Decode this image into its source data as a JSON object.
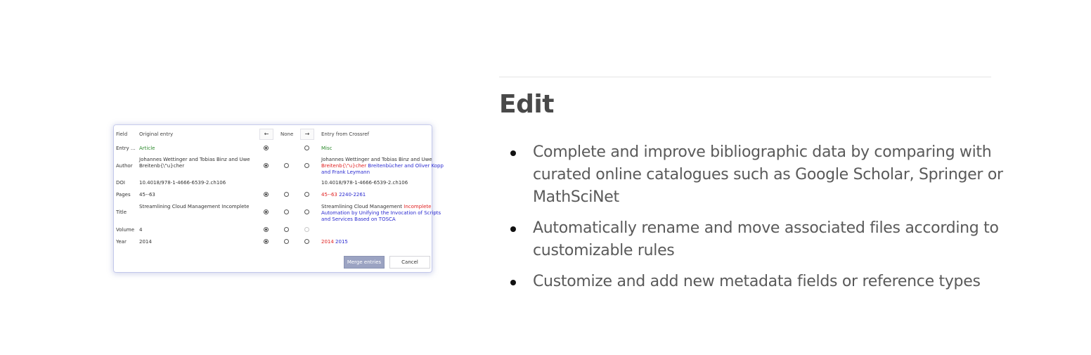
{
  "dialog": {
    "headers": {
      "field": "Field",
      "original": "Original entry",
      "left_arrow": "←",
      "none": "None",
      "right_arrow": "→",
      "crossref": "Entry from Crossref"
    },
    "rows": [
      {
        "field": "Entry ...",
        "original": "Article",
        "crossref": "Misc"
      },
      {
        "field": "Author",
        "original_line1": "Johannes Wettinger and Tobias Binz and Uwe",
        "original_line2": "Breitenb{\\\"u}cher",
        "crossref_line1": "Johannes Wettinger and Tobias Binz and Uwe",
        "crossref_line2_red": "Breitenb{\\\"u}cher",
        "crossref_line2_blue": " Breitenbücher and Oliver Kopp",
        "crossref_line3_blue": "and Frank Leymann"
      },
      {
        "field": "DOI",
        "original": "10.4018/978-1-4666-6539-2.ch106",
        "crossref": "10.4018/978-1-4666-6539-2.ch106"
      },
      {
        "field": "Pages",
        "original": "45--63",
        "crossref_red": "45--63",
        "crossref_blue": " 2240-2261"
      },
      {
        "field": "Title",
        "original": "Streamlining Cloud Management Incomplete",
        "crossref_line1_black": "Streamlining Cloud Management ",
        "crossref_line1_red": "Incomplete",
        "crossref_line2_blue": "Automation by Unifying the Invocation of Scripts",
        "crossref_line3_blue": "and Services Based on TOSCA"
      },
      {
        "field": "Volume",
        "original": "4"
      },
      {
        "field": "Year",
        "original": "2014",
        "crossref_red": "2014",
        "crossref_blue": " 2015"
      }
    ],
    "merge_label": "Merge entries",
    "cancel_label": "Cancel"
  },
  "section": {
    "heading": "Edit",
    "features": [
      "Complete and improve bibliographic data by comparing with curated online catalogues such as Google Scholar, Springer or MathSciNet",
      "Automatically rename and move associated files according to customizable rules",
      "Customize and add new metadata fields or reference types"
    ]
  },
  "colors": {
    "heading": "#494949",
    "text": "#5a5a5a",
    "merge_button": "#9ba3c2",
    "removed_text": "#e02020",
    "added_text": "#2a2ad0",
    "type_text": "#2e8b2e"
  }
}
